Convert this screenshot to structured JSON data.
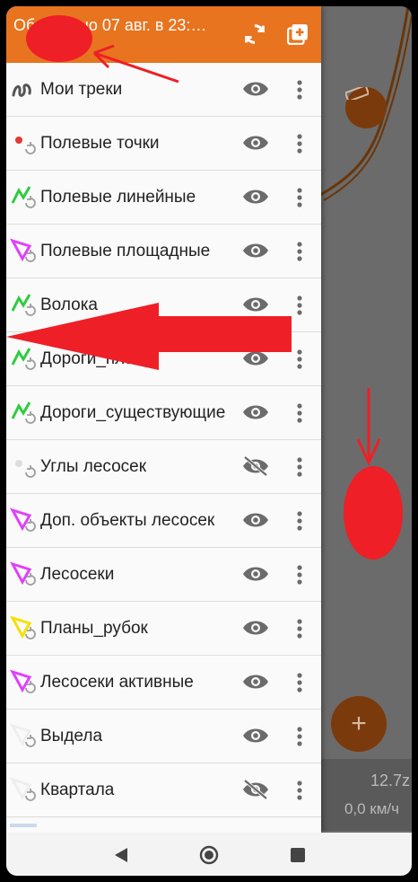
{
  "header": {
    "title": "Обновлено 07 авг. в 23:…",
    "sync_icon": "sync-icon",
    "add_layer_icon": "add-layer-icon"
  },
  "layers": [
    {
      "label": "Мои треки",
      "icon": "track-icon",
      "icon_color": "#555555",
      "visible": true
    },
    {
      "label": "Полевые точки",
      "icon": "point-sync-icon",
      "icon_color": "#e53935",
      "visible": true
    },
    {
      "label": "Полевые линейные",
      "icon": "line-sync-icon",
      "icon_color": "#2ecc40",
      "visible": true
    },
    {
      "label": "Полевые площадные",
      "icon": "polygon-sync-icon",
      "icon_color": "#e040fb",
      "visible": true
    },
    {
      "label": "Волока",
      "icon": "line-sync-icon",
      "icon_color": "#2ecc40",
      "visible": true
    },
    {
      "label": "Дороги_план",
      "icon": "line-sync-icon",
      "icon_color": "#2ecc40",
      "visible": true
    },
    {
      "label": "Дороги_существующие",
      "icon": "line-sync-icon",
      "icon_color": "#2ecc40",
      "visible": true
    },
    {
      "label": "Углы лесосек",
      "icon": "point-sync-icon",
      "icon_color": "#dddddd",
      "visible": false
    },
    {
      "label": "Доп. объекты лесосек",
      "icon": "polygon-sync-icon",
      "icon_color": "#e040fb",
      "visible": true
    },
    {
      "label": "Лесосеки",
      "icon": "polygon-sync-icon",
      "icon_color": "#e040fb",
      "visible": true
    },
    {
      "label": "Планы_рубок",
      "icon": "polygon-sync-icon",
      "icon_color": "#f5e000",
      "visible": true
    },
    {
      "label": "Лесосеки активные",
      "icon": "polygon-sync-icon",
      "icon_color": "#e040fb",
      "visible": true
    },
    {
      "label": "Выдела",
      "icon": "polygon-sync-icon",
      "icon_color": "#eeeeee",
      "visible": true
    },
    {
      "label": "Квартала",
      "icon": "polygon-sync-icon",
      "icon_color": "#eeeeee",
      "visible": false
    }
  ],
  "map": {
    "zoom_text": "12.7z",
    "speed_text": "0,0 км/ч",
    "ruler_icon": "ruler-icon",
    "add_icon": "plus-icon",
    "add_label": "+"
  },
  "navbar": {
    "back_icon": "back-triangle-icon",
    "home_icon": "home-circle-icon",
    "recents_icon": "recents-square-icon"
  },
  "colors": {
    "header": "#e8741f",
    "accent_dark": "#7a3a0c",
    "annotation_red": "#ee1f26"
  }
}
